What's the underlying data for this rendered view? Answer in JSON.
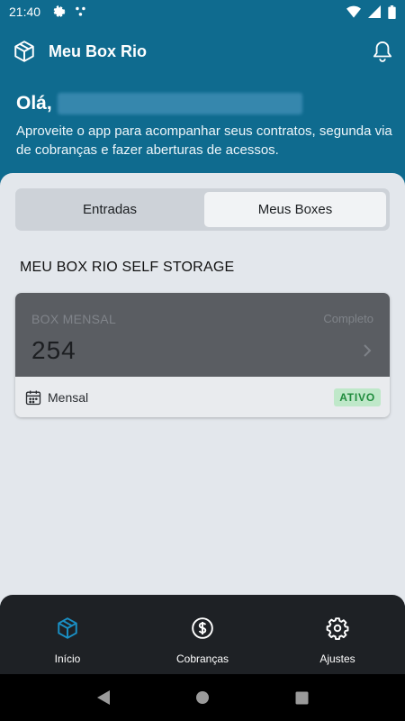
{
  "status_bar": {
    "time": "21:40"
  },
  "app_bar": {
    "title": "Meu Box Rio"
  },
  "greeting": {
    "hello": "Olá,",
    "subtitle": "Aproveite o app para acompanhar seus contratos, segunda via de cobranças e fazer aberturas de acessos."
  },
  "tabs": [
    {
      "label": "Entradas",
      "active": false
    },
    {
      "label": "Meus Boxes",
      "active": true
    }
  ],
  "section": {
    "title": "MEU BOX RIO SELF STORAGE"
  },
  "box_card": {
    "type": "BOX MENSAL",
    "status": "Completo",
    "number": "254",
    "plan": "Mensal",
    "badge": "ATIVO"
  },
  "bottom_nav": [
    {
      "label": "Início",
      "icon": "cube-icon",
      "active": true
    },
    {
      "label": "Cobranças",
      "icon": "dollar-circle-icon",
      "active": false
    },
    {
      "label": "Ajustes",
      "icon": "gear-icon",
      "active": false
    }
  ],
  "colors": {
    "primary": "#0f6b8f",
    "content_bg": "#e3e7ec",
    "card_dark": "#5a5d62",
    "nav_bg": "#1e2125",
    "active_icon": "#1a8fc4",
    "badge_bg": "#bfe8c9",
    "badge_text": "#1f8b3c"
  }
}
